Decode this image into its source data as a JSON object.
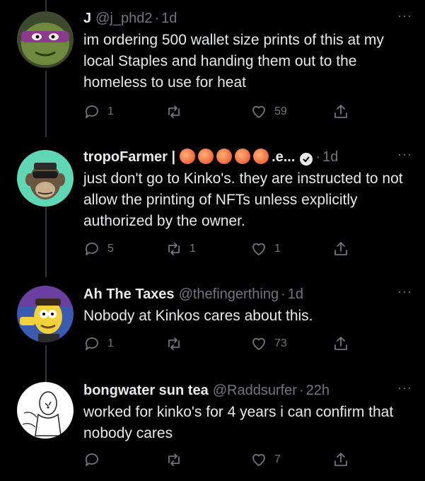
{
  "tweets": [
    {
      "name": "J",
      "handle": "@j_phd2",
      "time": "1d",
      "text": "im ordering 500 wallet size prints of this at my local Staples and handing them out to the homeless to use for heat",
      "replies": "1",
      "retweets": "",
      "likes": "59",
      "avatar": "ninja-turtle"
    },
    {
      "name": "tropoFarmer |",
      "name_suffix": ".e...",
      "handle": "",
      "time": "1d",
      "text": "just don't go to Kinko's. they are instructed to not allow the printing of NFTs unless explicitly authorized by the owner.",
      "replies": "5",
      "retweets": "1",
      "likes": "1",
      "avatar": "bored-ape",
      "emoji": "peach"
    },
    {
      "name": "Ah The Taxes",
      "handle": "@thefingerthing",
      "time": "1d",
      "text": "Nobody at Kinkos cares about this.",
      "replies": "1",
      "retweets": "",
      "likes": "73",
      "avatar": "cartoon-character"
    },
    {
      "name": "bongwater sun tea",
      "handle": "@Raddsurfer",
      "time": "22h",
      "text": "worked for kinko's for 4 years i can confirm that nobody cares",
      "replies": "",
      "retweets": "",
      "likes": "7",
      "avatar": "sketch-drawing"
    }
  ],
  "ui": {
    "dot": "·",
    "more": "···"
  },
  "colors": {
    "background": "#000000",
    "text": "#e7e9ea",
    "secondary": "#71767b",
    "thread_line": "#333639"
  }
}
